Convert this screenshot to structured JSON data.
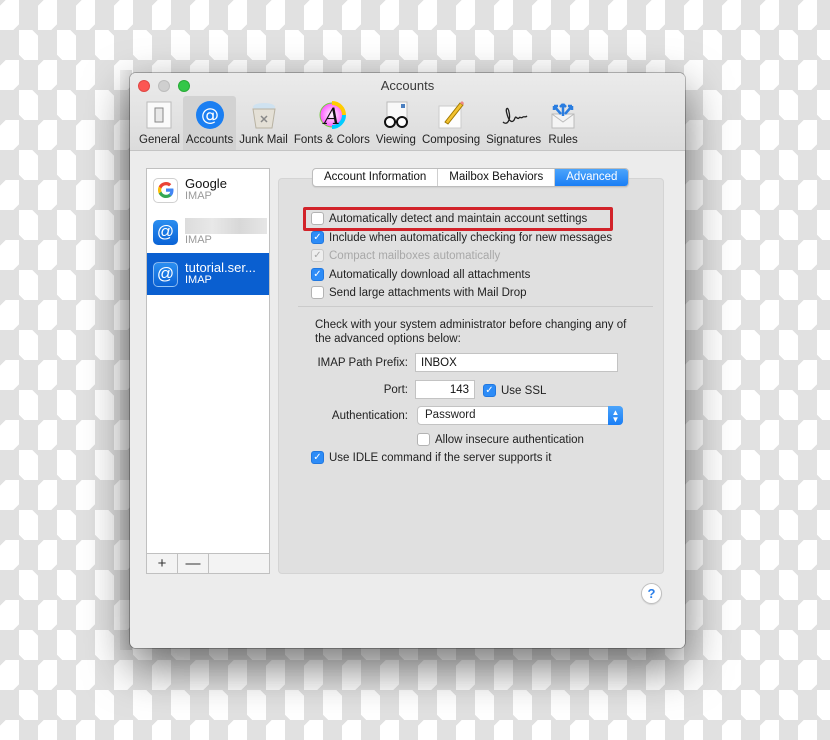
{
  "window": {
    "title": "Accounts"
  },
  "toolbar": {
    "items": [
      {
        "label": "General",
        "icon": "general-icon",
        "active": false
      },
      {
        "label": "Accounts",
        "icon": "accounts-at-icon",
        "active": true
      },
      {
        "label": "Junk Mail",
        "icon": "junk-mail-icon",
        "active": false
      },
      {
        "label": "Fonts & Colors",
        "icon": "fonts-colors-icon",
        "active": false
      },
      {
        "label": "Viewing",
        "icon": "viewing-glasses-icon",
        "active": false
      },
      {
        "label": "Composing",
        "icon": "composing-pencil-icon",
        "active": false
      },
      {
        "label": "Signatures",
        "icon": "signature-icon",
        "active": false
      },
      {
        "label": "Rules",
        "icon": "rules-envelope-icon",
        "active": false
      }
    ]
  },
  "accounts": {
    "items": [
      {
        "name": "Google",
        "type": "IMAP",
        "icon": "google-icon",
        "selected": false
      },
      {
        "name": "",
        "type": "IMAP",
        "icon": "at-icon",
        "selected": false,
        "name_blurred": true
      },
      {
        "name": "tutorial.ser...",
        "type": "IMAP",
        "icon": "at-icon",
        "selected": true
      }
    ],
    "add_label": "+",
    "remove_label": "—"
  },
  "tabs": [
    {
      "label": "Account Information",
      "active": false
    },
    {
      "label": "Mailbox Behaviors",
      "active": false
    },
    {
      "label": "Advanced",
      "active": true
    }
  ],
  "advanced": {
    "options": [
      {
        "label": "Automatically detect and maintain account settings",
        "checked": false,
        "disabled": false,
        "highlighted": true
      },
      {
        "label": "Include when automatically checking for new messages",
        "checked": true,
        "disabled": false
      },
      {
        "label": "Compact mailboxes automatically",
        "checked": true,
        "disabled": true
      },
      {
        "label": "Automatically download all attachments",
        "checked": true,
        "disabled": false
      },
      {
        "label": "Send large attachments with Mail Drop",
        "checked": false,
        "disabled": false
      }
    ],
    "note": "Check with your system administrator before changing any of the advanced options below:",
    "imap_path_prefix": {
      "label": "IMAP Path Prefix:",
      "value": "INBOX"
    },
    "port": {
      "label": "Port:",
      "value": "143"
    },
    "use_ssl": {
      "label": "Use SSL",
      "checked": true
    },
    "authentication": {
      "label": "Authentication:",
      "value": "Password"
    },
    "allow_insecure": {
      "label": "Allow insecure authentication",
      "checked": false
    },
    "use_idle": {
      "label": "Use IDLE command if the server supports it",
      "checked": true
    }
  },
  "help": {
    "label": "?"
  },
  "colors": {
    "accent": "#1a7ef5",
    "selection": "#0a5fd0",
    "highlight_box": "#d2232a",
    "close": "#fc5753",
    "minimize": "#cfcfcf",
    "zoom": "#33c748"
  }
}
